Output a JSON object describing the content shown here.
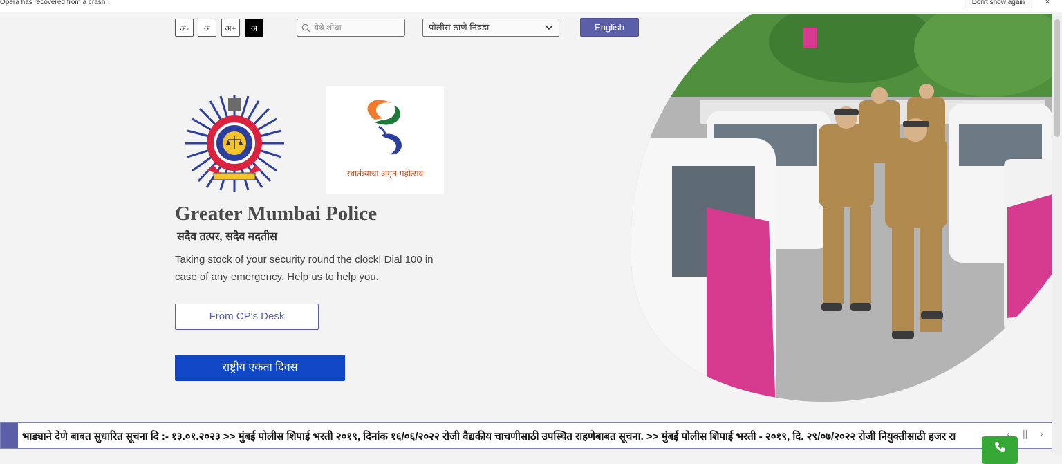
{
  "notice": {
    "text": "Opera has recovered from a crash.",
    "dont_show_label": "Don't show again",
    "close_glyph": "×"
  },
  "toolbar": {
    "font_buttons": [
      "अ-",
      "अ",
      "अ+",
      "अ"
    ],
    "search_placeholder": "येथे शोधा",
    "station_select_value": "पोलीस ठाणे निवडा",
    "language_button": "English"
  },
  "hero": {
    "title": "Greater Mumbai Police",
    "motto": "सदैव तत्पर, सदैव मदतीस",
    "tagline": "Taking stock of your security round the clock! Dial 100 in case of any emergency. Help us to help you.",
    "cp_desk_button": "From CP's Desk",
    "unity_day_button": "राष्ट्रीय एकता दिवस",
    "azadi_caption": "स्वातंत्र्याचा अमृत महोत्सव"
  },
  "ticker": {
    "text": "भाड्याने देणे बाबत सुधारित सूचना दि :- १३.०१.२०२३    >> मुंबई पोलीस शिपाई भरती २०१९, दिनांक १६/०६/२०२२ रोजी वैद्यकीय चाचणीसाठी उपस्थित राहणेबाबत सूचना.    >> मुंबई पोलीस शिपाई भरती - २०१९, दि. २९/०७/२०२२ रोजी नियुक्तीसाठी हजर रा",
    "prev_glyph": "‹",
    "pause_glyph": "||",
    "next_glyph": "›"
  },
  "icons": {
    "search": "search-icon",
    "chevron": "chevron-down-icon",
    "phone": "phone-icon"
  },
  "colors": {
    "accent": "#5b5fa8",
    "primary_button": "#0f47c5",
    "call_button": "#35a835",
    "background": "#f3f3f3"
  }
}
